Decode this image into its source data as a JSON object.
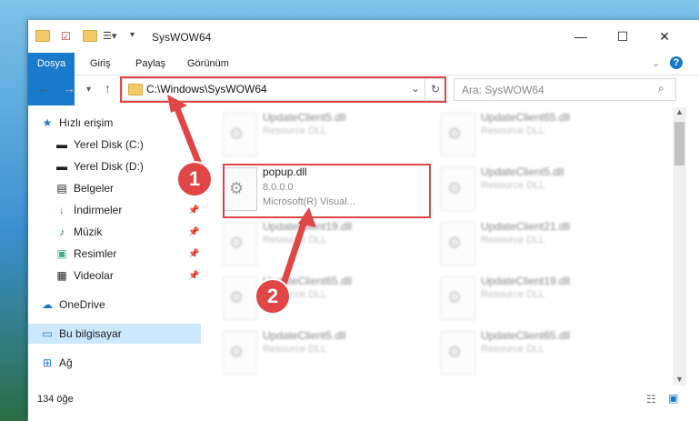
{
  "window": {
    "title": "SysWOW64"
  },
  "ribbon": {
    "tabs": [
      "Dosya",
      "Giriş",
      "Paylaş",
      "Görünüm"
    ]
  },
  "nav": {
    "address": "C:\\Windows\\SysWOW64",
    "search_placeholder": "Ara: SysWOW64"
  },
  "sidebar": {
    "items": [
      {
        "label": "Hızlı erişim",
        "icon": "star-icon"
      },
      {
        "label": "Yerel Disk (C:)",
        "icon": "drive-icon"
      },
      {
        "label": "Yerel Disk (D:)",
        "icon": "drive-icon"
      },
      {
        "label": "Belgeler",
        "icon": "document-icon"
      },
      {
        "label": "İndirmeler",
        "icon": "download-icon"
      },
      {
        "label": "Müzik",
        "icon": "music-icon"
      },
      {
        "label": "Resimler",
        "icon": "picture-icon"
      },
      {
        "label": "Videolar",
        "icon": "video-icon"
      },
      {
        "label": "OneDrive",
        "icon": "cloud-icon"
      },
      {
        "label": "Bu bilgisayar",
        "icon": "computer-icon"
      },
      {
        "label": "Ağ",
        "icon": "network-icon"
      }
    ]
  },
  "files": [
    {
      "name": "UpdateClient5.dll",
      "line1": "Resource DLL"
    },
    {
      "name": "UpdateClient65.dll",
      "line1": "Resource DLL"
    },
    {
      "name": "popup.dll",
      "line1": "8.0.0.0",
      "line2": "Microsoft(R) Visual..."
    },
    {
      "name": "UpdateClient5.dll",
      "line1": "Resource DLL"
    },
    {
      "name": "UpdateClient19.dll",
      "line1": "Resource DLL"
    },
    {
      "name": "UpdateClient21.dll",
      "line1": "Resource DLL"
    },
    {
      "name": "UpdateClient65.dll",
      "line1": "Resource DLL"
    },
    {
      "name": "UpdateClient19.dll",
      "line1": "Resource DLL"
    },
    {
      "name": "UpdateClient5.dll",
      "line1": "Resource DLL"
    },
    {
      "name": "UpdateClient65.dll",
      "line1": "Resource DLL"
    }
  ],
  "status": {
    "count": "134 öğe"
  },
  "badges": [
    "1",
    "2"
  ],
  "colors": {
    "accent": "#1979ca",
    "highlight": "#e04646",
    "selected": "#cce8ff"
  }
}
